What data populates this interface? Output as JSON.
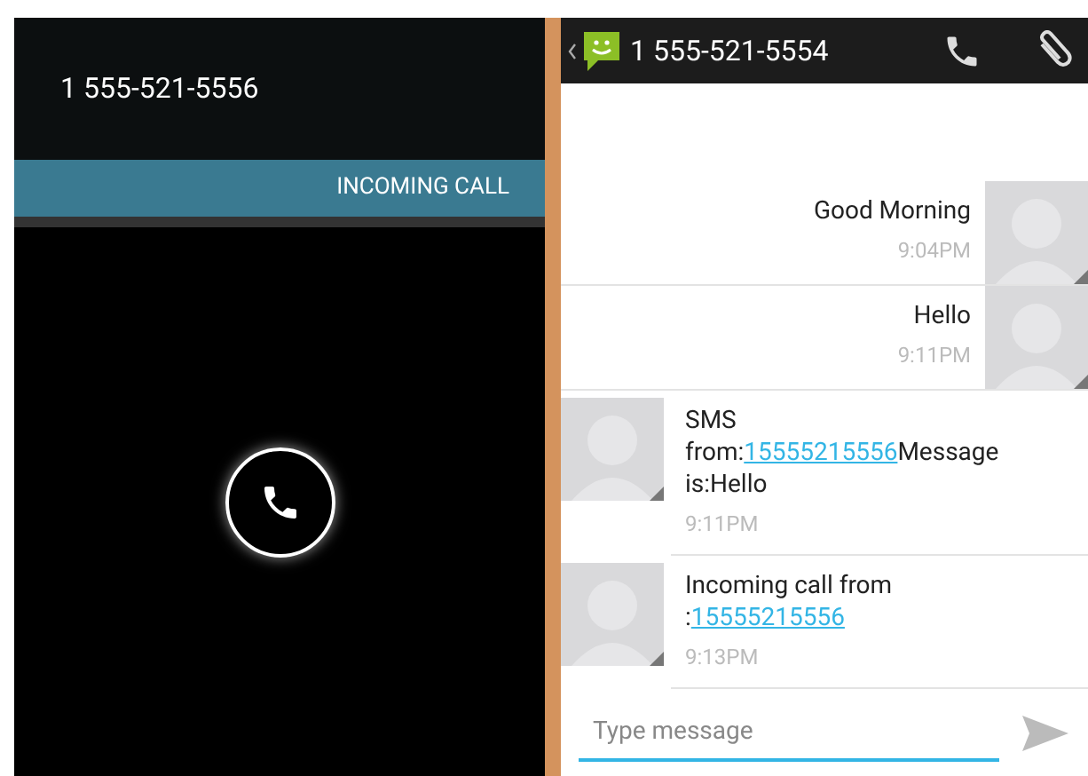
{
  "call_screen": {
    "caller_number": "1 555-521-5556",
    "status_banner": "INCOMING CALL"
  },
  "conversation": {
    "contact_number": "1 555-521-5554",
    "messages": [
      {
        "kind": "outgoing",
        "parts": [
          {
            "kind": "text",
            "text": "Good Morning"
          }
        ],
        "time": "9:04PM"
      },
      {
        "kind": "outgoing",
        "parts": [
          {
            "kind": "text",
            "text": "Hello"
          }
        ],
        "time": "9:11PM"
      },
      {
        "kind": "incoming",
        "parts": [
          {
            "kind": "text",
            "text": "SMS from:"
          },
          {
            "kind": "link",
            "text": "15555215556"
          },
          {
            "kind": "text",
            "text": "Message is:Hello"
          }
        ],
        "time": "9:11PM"
      },
      {
        "kind": "incoming",
        "parts": [
          {
            "kind": "text",
            "text": "Incoming call from :"
          },
          {
            "kind": "link",
            "text": "15555215556"
          }
        ],
        "time": "9:13PM"
      }
    ],
    "composer": {
      "placeholder": "Type message"
    }
  }
}
